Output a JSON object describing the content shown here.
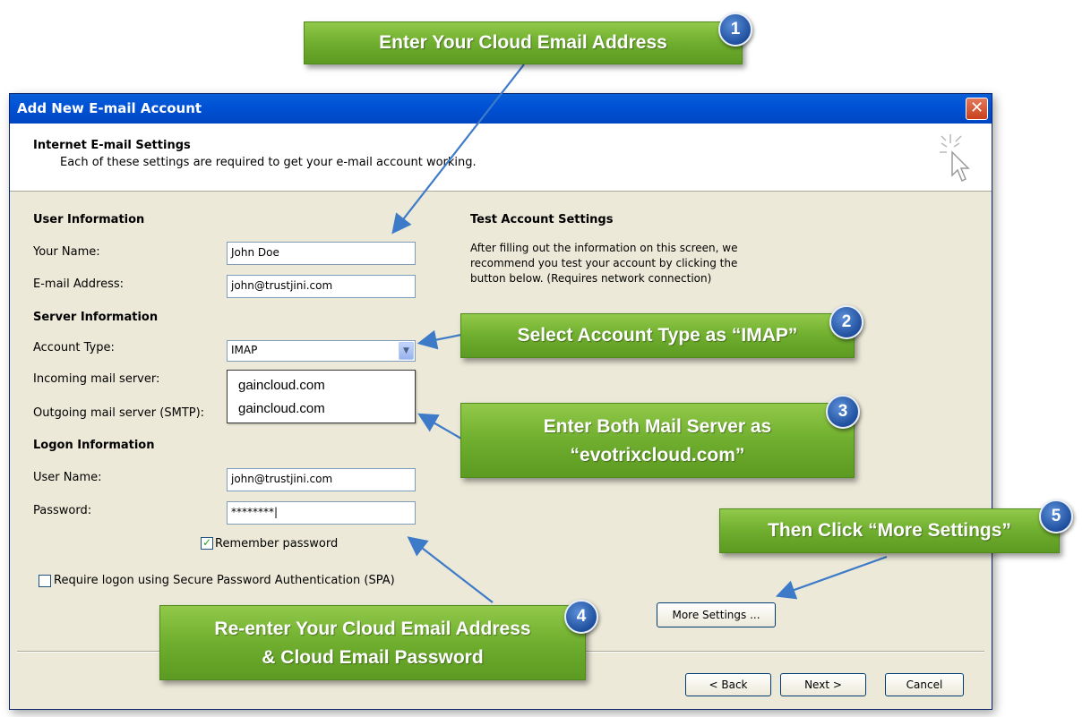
{
  "window": {
    "title": "Add New E-mail Account",
    "close_label": "✕"
  },
  "header": {
    "title": "Internet E-mail Settings",
    "subtitle": "Each of these settings are required to get your e-mail account working."
  },
  "user_info": {
    "section": "User Information",
    "name_label": "Your Name:",
    "name_value": "John Doe",
    "email_label": "E-mail Address:",
    "email_value": "john@trustjini.com"
  },
  "server_info": {
    "section": "Server Information",
    "account_type_label": "Account Type:",
    "account_type_value": "IMAP",
    "incoming_label": "Incoming mail server:",
    "incoming_value": "gaincloud.com",
    "outgoing_label": "Outgoing mail server (SMTP):",
    "outgoing_value": "gaincloud.com"
  },
  "logon_info": {
    "section": "Logon Information",
    "username_label": "User Name:",
    "username_value": "john@trustjini.com",
    "password_label": "Password:",
    "password_value": "********|",
    "remember_label": "Remember password",
    "remember_checked": true,
    "spa_label": "Require logon using Secure Password Authentication (SPA)",
    "spa_checked": false
  },
  "test_settings": {
    "section": "Test Account Settings",
    "line1": "After filling out the information on this screen, we",
    "line2": "recommend you test your account by clicking the",
    "line3": "button below. (Requires network connection)"
  },
  "buttons": {
    "more_settings": "More Settings ...",
    "back": "< Back",
    "next": "Next >",
    "cancel": "Cancel"
  },
  "callouts": {
    "c1": "Enter Your Cloud Email Address",
    "c2": "Select Account Type as “IMAP”",
    "c3_line1": "Enter Both Mail Server as",
    "c3_line2": "“evotrixcloud.com”",
    "c4_line1": "Re-enter Your Cloud Email Address",
    "c4_line2": "& Cloud Email Password",
    "c5": "Then Click “More Settings”"
  },
  "badges": {
    "b1": "1",
    "b2": "2",
    "b3": "3",
    "b4": "4",
    "b5": "5"
  },
  "colors": {
    "callout_green": "#6fae2e",
    "badge_blue": "#1f4f9e",
    "titlebar_blue": "#0052d6",
    "arrow_blue": "#3d7bc9"
  }
}
